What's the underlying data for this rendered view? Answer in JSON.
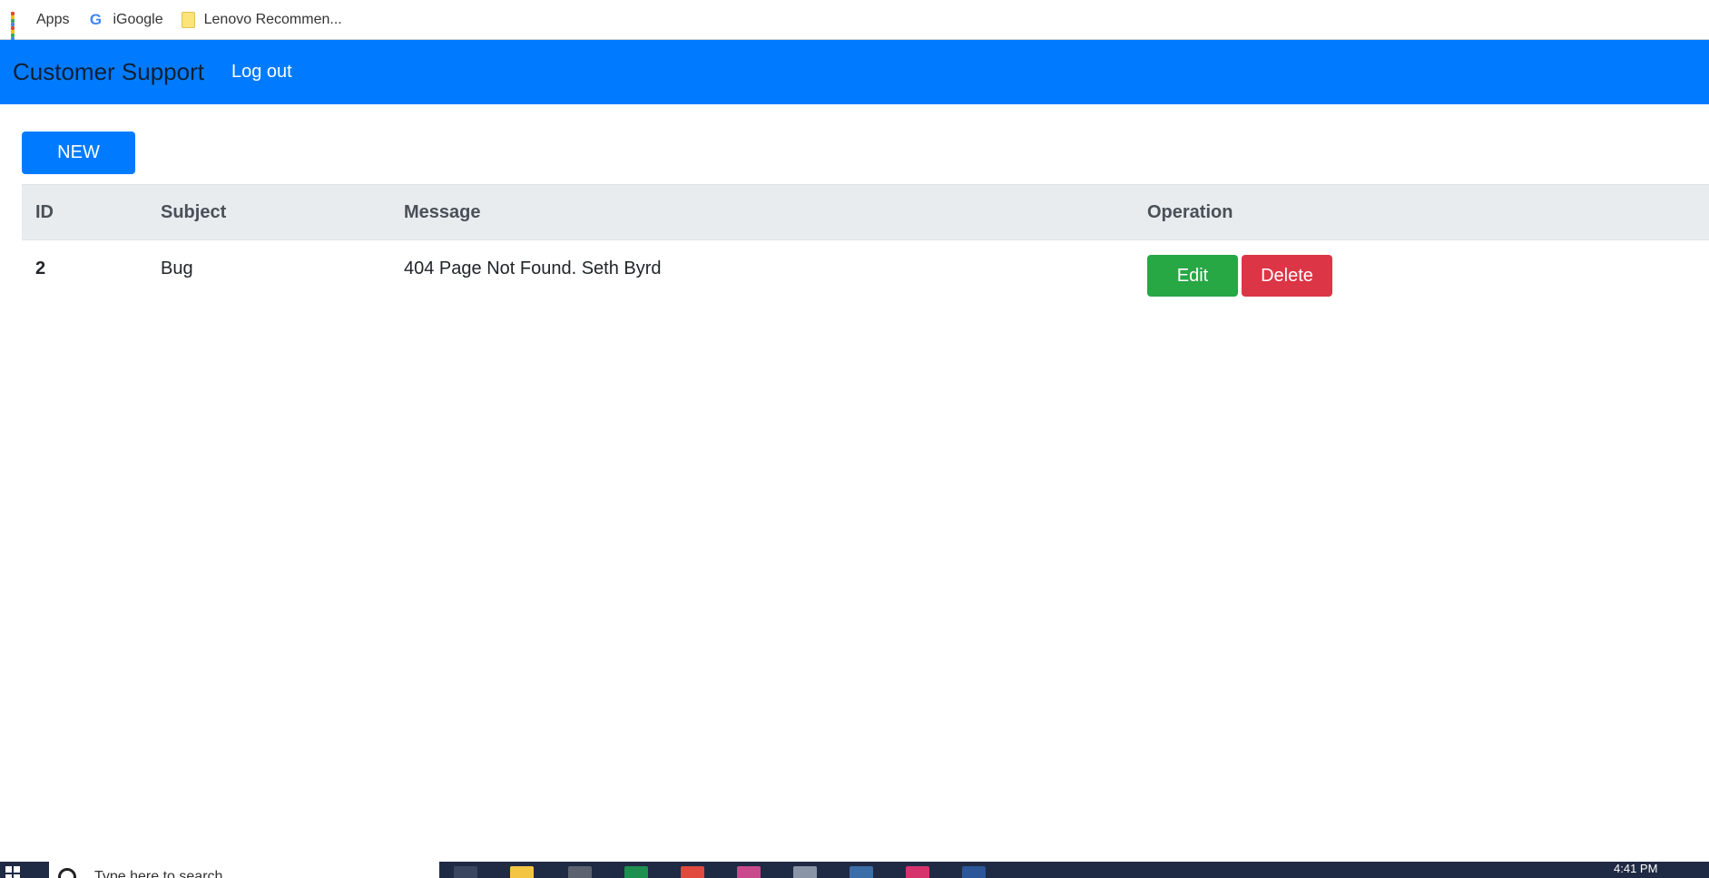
{
  "bookmarks": [
    {
      "label": "Apps",
      "icon": "apps-grid-icon"
    },
    {
      "label": "iGoogle",
      "icon": "google-g-icon"
    },
    {
      "label": "Lenovo Recommen...",
      "icon": "folder-icon"
    }
  ],
  "navbar": {
    "brand": "Customer Support",
    "logout_label": "Log out",
    "color": "#007bff"
  },
  "toolbar": {
    "new_label": "NEW"
  },
  "table": {
    "columns": [
      "ID",
      "Subject",
      "Message",
      "Operation"
    ],
    "rows": [
      {
        "id": "2",
        "subject": "Bug",
        "message": "404 Page Not Found. Seth Byrd",
        "edit_label": "Edit",
        "delete_label": "Delete"
      }
    ]
  },
  "colors": {
    "primary": "#007bff",
    "success": "#28a745",
    "danger": "#dc3545",
    "table_header_bg": "#e9ecef"
  },
  "taskbar": {
    "search_placeholder": "Type here to search",
    "time": "4:41 PM"
  }
}
